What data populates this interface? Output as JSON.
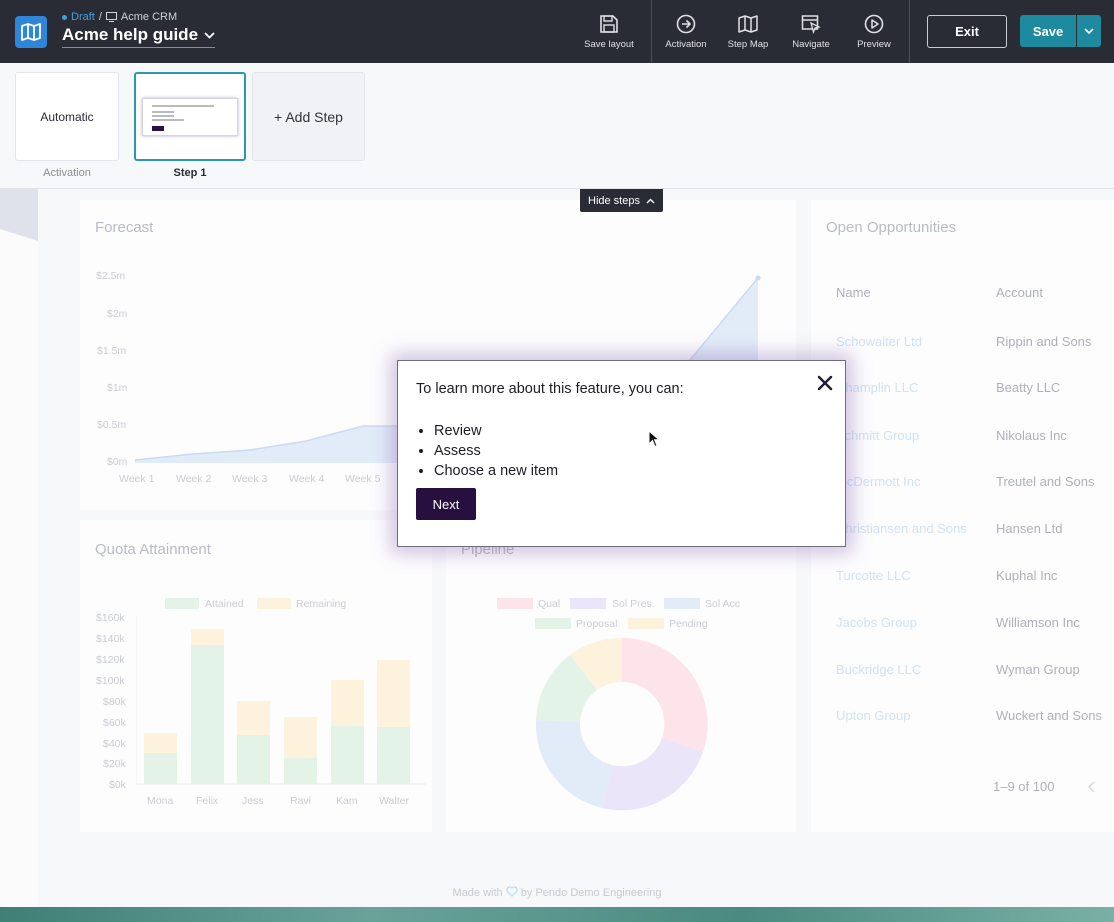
{
  "toolbar": {
    "breadcrumb_status": "Draft",
    "breadcrumb_sep": "/",
    "breadcrumb_app": "Acme CRM",
    "guide_title": "Acme help guide",
    "tools": [
      {
        "label": "Save layout",
        "icon": "floppy-icon"
      },
      {
        "label": "Activation",
        "icon": "arrow-circle-icon"
      },
      {
        "label": "Step Map",
        "icon": "map-icon"
      },
      {
        "label": "Navigate",
        "icon": "cursor-window-icon"
      },
      {
        "label": "Preview",
        "icon": "play-circle-icon"
      }
    ],
    "exit_label": "Exit",
    "save_label": "Save",
    "accent": "#1e8aa0"
  },
  "steps": {
    "cards": [
      {
        "title": "Automatic",
        "caption": "Activation"
      },
      {
        "title": "",
        "caption": "Step 1"
      },
      {
        "title": "+ Add Step",
        "caption": ""
      }
    ],
    "hide_label": "Hide steps"
  },
  "dashboard": {
    "forecast": {
      "title": "Forecast",
      "yticks": [
        "$2.5m",
        "$2m",
        "$1.5m",
        "$1m",
        "$0.5m",
        "$0m"
      ],
      "xticks": [
        "Week 1",
        "Week 2",
        "Week 3",
        "Week 4",
        "Week 5"
      ]
    },
    "quota": {
      "title": "Quota Attainment",
      "legend": [
        "Attained",
        "Remaining"
      ],
      "yticks": [
        "$160k",
        "$140k",
        "$120k",
        "$100k",
        "$80k",
        "$60k",
        "$40k",
        "$20k",
        "$0k"
      ],
      "names": [
        "Mona",
        "Felix",
        "Jess",
        "Ravi",
        "Kam",
        "Walter"
      ]
    },
    "pipeline": {
      "title": "Pipeline",
      "legend": [
        "Qual",
        "Sol Pres.",
        "Sol Acc",
        "Proposal",
        "Pending"
      ]
    },
    "opportunities": {
      "title": "Open Opportunities",
      "col_name": "Name",
      "col_account": "Account",
      "rows": [
        {
          "name": "Schowalter Ltd",
          "account": "Rippin and Sons"
        },
        {
          "name": "Champlin LLC",
          "account": "Beatty LLC"
        },
        {
          "name": "Schmitt Group",
          "account": "Nikolaus Inc"
        },
        {
          "name": "McDermott Inc",
          "account": "Treutel and Sons"
        },
        {
          "name": "Christiansen and Sons",
          "account": "Hansen Ltd"
        },
        {
          "name": "Turcotte LLC",
          "account": "Kuphal Inc"
        },
        {
          "name": "Jacobs Group",
          "account": "Williamson Inc"
        },
        {
          "name": "Buckridge LLC",
          "account": "Wyman Group"
        },
        {
          "name": "Upton Group",
          "account": "Wuckert and Sons"
        }
      ],
      "pagination": "1–9 of 100"
    },
    "footer_pre": "Made with",
    "footer_post": "by Pendo Demo Engineering"
  },
  "guide": {
    "heading": "To learn more about this feature, you can:",
    "items": [
      "Review",
      "Assess",
      "Choose a new item"
    ],
    "next_label": "Next"
  }
}
